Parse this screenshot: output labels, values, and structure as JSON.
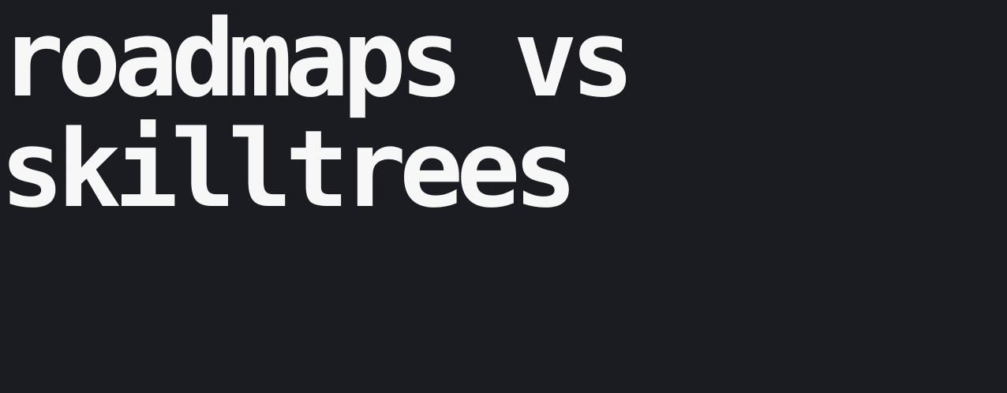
{
  "title": {
    "line1": "roadmaps vs",
    "line2": "skilltrees"
  },
  "colors": {
    "background": "#1b1c21",
    "text": "#f7f7f8"
  }
}
